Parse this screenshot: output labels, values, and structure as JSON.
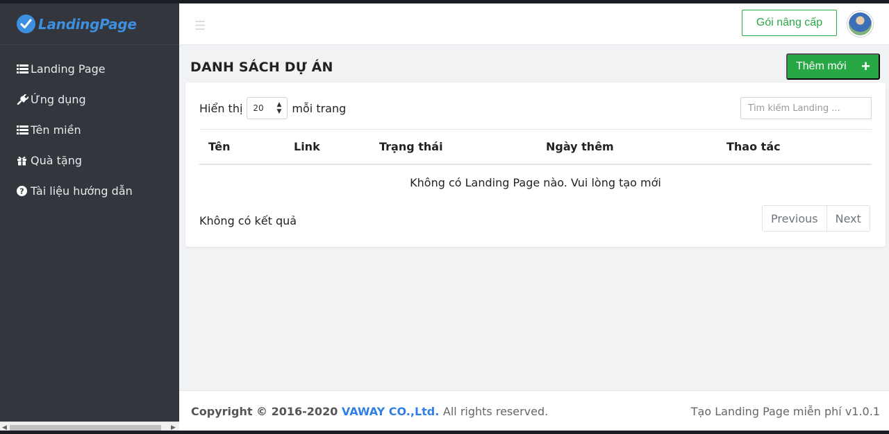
{
  "brand": {
    "name": "LandingPage"
  },
  "sidebar": {
    "items": [
      {
        "label": "Landing Page",
        "icon": "list-icon"
      },
      {
        "label": "Ứng dụng",
        "icon": "plug-icon"
      },
      {
        "label": "Tên miền",
        "icon": "list-icon"
      },
      {
        "label": "Quà tặng",
        "icon": "gift-icon"
      },
      {
        "label": "Tài liệu hướng dẫn",
        "icon": "question-circle-icon"
      }
    ]
  },
  "header": {
    "upgrade_label": "Gói nâng cấp"
  },
  "main": {
    "title": "DANH SÁCH DỰ ÁN",
    "add_label": "Thêm mới",
    "show_label": "Hiển thị",
    "page_size": "20",
    "per_page_label": "mỗi trang",
    "search_placeholder": "Tìm kiếm Landing ...",
    "columns": [
      "Tên",
      "Link",
      "Trạng thái",
      "Ngày thêm",
      "Thao tác"
    ],
    "empty_message": "Không có Landing Page nào. Vui lòng tạo mới",
    "result_info": "Không có kết quả",
    "pagination": {
      "previous": "Previous",
      "next": "Next"
    }
  },
  "footer": {
    "copyright_prefix": "Copyright © 2016-2020",
    "company": "VAWAY CO.,Ltd.",
    "rights": "All rights reserved.",
    "version": "Tạo Landing Page miễn phí v1.0.1"
  },
  "colors": {
    "accent": "#28a745",
    "brand": "#3d8fe0",
    "sidebar": "#33373d"
  }
}
